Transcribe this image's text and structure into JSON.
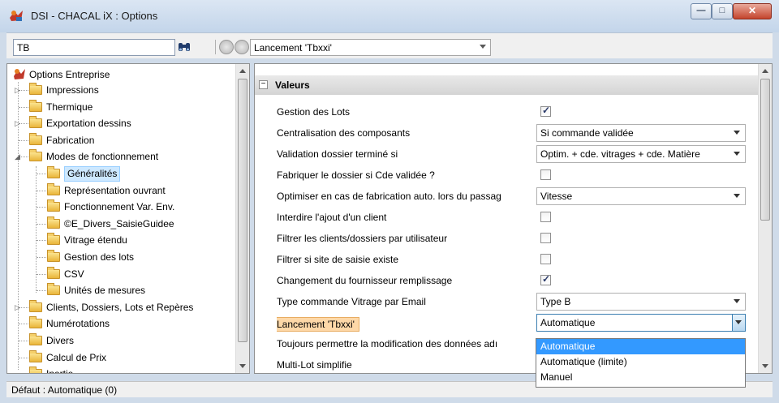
{
  "window": {
    "title": "DSI - CHACAL iX : Options",
    "minimize_glyph": "—",
    "maximize_glyph": "□",
    "close_glyph": "✕"
  },
  "toolbar": {
    "search_value": "TB",
    "icons": [
      "binoculars-icon",
      "back-icon",
      "forward-icon"
    ],
    "combo_value": "Lancement 'Tbxxi'"
  },
  "tree": {
    "root": "Options Entreprise",
    "items": [
      {
        "label": "Impressions",
        "level": 1,
        "expander": "▷"
      },
      {
        "label": "Thermique",
        "level": 1,
        "expander": ""
      },
      {
        "label": "Exportation dessins",
        "level": 1,
        "expander": "▷"
      },
      {
        "label": "Fabrication",
        "level": 1,
        "expander": ""
      },
      {
        "label": "Modes de fonctionnement",
        "level": 1,
        "expander": "◢"
      },
      {
        "label": "Généralités",
        "level": 2,
        "selected": true
      },
      {
        "label": "Représentation ouvrant",
        "level": 2
      },
      {
        "label": "Fonctionnement Var. Env.",
        "level": 2
      },
      {
        "label": "©E_Divers_SaisieGuidee",
        "level": 2
      },
      {
        "label": "Vitrage étendu",
        "level": 2
      },
      {
        "label": "Gestion des lots",
        "level": 2
      },
      {
        "label": "CSV",
        "level": 2
      },
      {
        "label": "Unités de mesures",
        "level": 2
      },
      {
        "label": "Clients, Dossiers, Lots et Repères",
        "level": 1,
        "expander": "▷"
      },
      {
        "label": "Numérotations",
        "level": 1,
        "expander": ""
      },
      {
        "label": "Divers",
        "level": 1,
        "expander": ""
      },
      {
        "label": "Calcul de Prix",
        "level": 1,
        "expander": ""
      },
      {
        "label": "Inertie",
        "level": 1,
        "expander": ""
      }
    ]
  },
  "grid": {
    "group_toggle": "−",
    "group_title": "Valeurs",
    "rows": [
      {
        "label": "Gestion des Lots",
        "type": "checkbox",
        "checked": true
      },
      {
        "label": "Centralisation des composants",
        "type": "combo",
        "value": "Si commande validée"
      },
      {
        "label": "Validation dossier terminé si",
        "type": "combo",
        "value": "Optim. + cde. vitrages + cde. Matière"
      },
      {
        "label": "Fabriquer le dossier si Cde validée ?",
        "type": "checkbox",
        "checked": false
      },
      {
        "label": "Optimiser en cas de fabrication auto. lors du passag",
        "type": "combo",
        "value": "Vitesse"
      },
      {
        "label": "Interdire l'ajout d'un client",
        "type": "checkbox",
        "checked": false
      },
      {
        "label": "Filtrer les clients/dossiers par utilisateur",
        "type": "checkbox",
        "checked": false
      },
      {
        "label": "Filtrer si site de saisie existe",
        "type": "checkbox",
        "checked": false
      },
      {
        "label": "Changement du fournisseur remplissage",
        "type": "checkbox",
        "checked": true
      },
      {
        "label": "Type commande Vitrage par Email",
        "type": "combo",
        "value": "Type B"
      },
      {
        "label": "Lancement 'Tbxxi'",
        "type": "combo",
        "value": "Automatique",
        "active": true
      },
      {
        "label": "Toujours permettre la modification des données adı",
        "type": "none"
      },
      {
        "label": "Multi-Lot simplifie",
        "type": "none"
      }
    ]
  },
  "dropdown": {
    "options": [
      "Automatique",
      "Automatique (limite)",
      "Manuel"
    ],
    "selected_index": 0
  },
  "status": {
    "text": "Défaut : Automatique (0)"
  }
}
